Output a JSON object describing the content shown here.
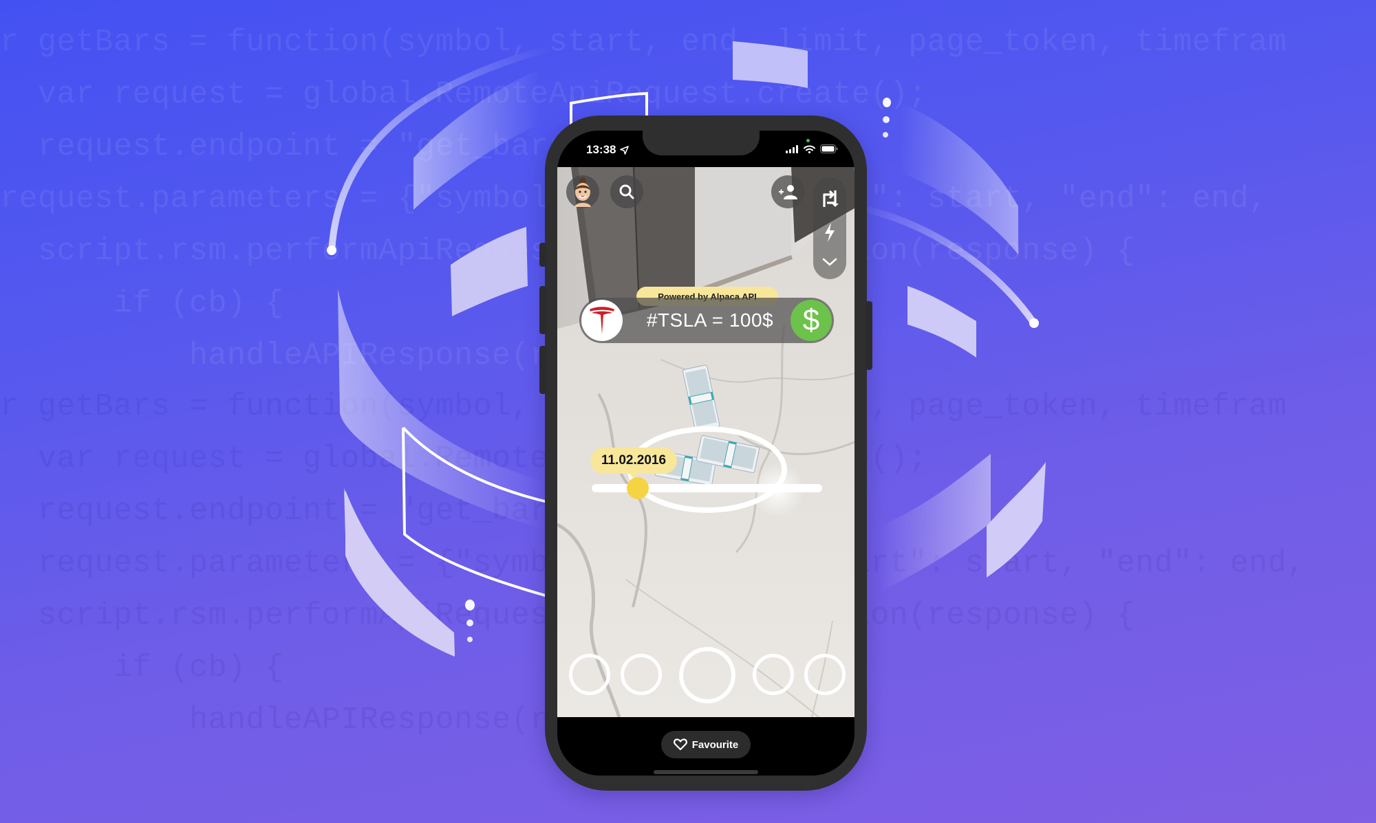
{
  "background": {
    "code_lines": [
      "r getBars = function(symbol, start, end, limit, page_token, timefram",
      "  var request = global.RemoteApiRequest.create();",
      "  request.endpoint = \"get_bars\";",
      "request.parameters = {\"symbol\": symbol, \"start\": start, \"end\": end,",
      "  script.rsm.performApiRequest(request, function(response) {",
      "      if (cb) {",
      "          handleAPIResponse(response, cb);",
      "r getBars = function(symbol, start, end, limit, page_token, timefram",
      "  var request = global.RemoteApiRequest.create();",
      "  request.endpoint = \"get_bars\";",
      "  request.parameters = {\"symbol\": symbol, \"start\": start, \"end\": end,",
      "  script.rsm.performApiRequest(request, function(response) {",
      "      if (cb) {",
      "          handleAPIResponse(response, cb);"
    ],
    "colors": {
      "top": "#4451f2",
      "bottom": "#7f5fe4"
    }
  },
  "status_bar": {
    "time": "13:38",
    "location_icon": "location-arrow-icon",
    "signal_icon": "cellular-signal-icon",
    "wifi_icon": "wifi-icon",
    "battery_icon": "battery-icon"
  },
  "top_controls": {
    "avatar": "bitmoji-avatar",
    "search_icon": "search-icon",
    "add_friend_icon": "add-friend-icon",
    "toolbar": [
      "flip-camera-icon",
      "flash-icon",
      "chevron-down-icon"
    ]
  },
  "ar_overlay": {
    "powered_by": "Powered by Alpaca API",
    "ticker_logo": "tesla-logo",
    "ticker_text": "#TSLA = 100$",
    "dollar_symbol": "$",
    "date_label": "11.02.2016",
    "slider_fraction": 0.2,
    "accent_yellow": "#f8e79a",
    "thumb_yellow": "#f5d444",
    "dollar_green": "#6cc24a",
    "tesla_red": "#cc2027"
  },
  "lens_carousel": {
    "count": 5,
    "selected_index": 2
  },
  "bottom_bar": {
    "favourite_label": "Favourite",
    "favourite_icon": "heart-icon"
  }
}
